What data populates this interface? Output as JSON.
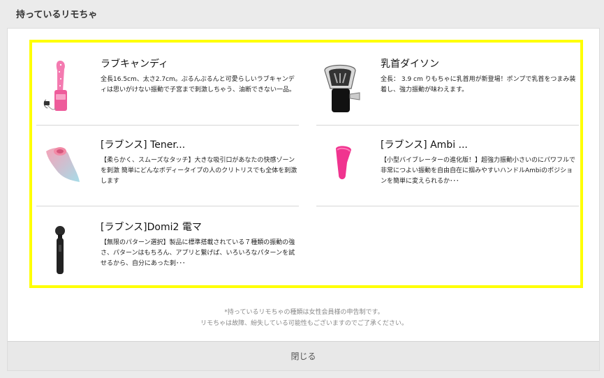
{
  "header": {
    "title": "持っているリモちゃ"
  },
  "items": [
    {
      "name": "ラブキャンディ",
      "description": "全長16.5cm、太さ2.7cm。ぷるんぷるんと可愛らしいラブキャンディは思いがけない振動で子宮まで刺激しちゃう、油断できない一品。",
      "icon": "pink-vibrator-image"
    },
    {
      "name": "乳首ダイソン",
      "description": "全長： 3.9 cm りもちゃに乳首用が新登場！ポンプで乳首をつまみ装着し、強力振動が味わえます。",
      "icon": "nipple-pump-image"
    },
    {
      "name": "[ラブンス] Tener...",
      "description": "【柔らかく、スムーズなタッチ】大きな吸引口があなたの快感ゾーンを刺激 簡単にどんなボディータイプの人のクリトリスでも全体を刺激します",
      "icon": "gradient-suction-toy-image"
    },
    {
      "name": "[ラブンス] Ambi ...",
      "description": "【小型バイブレーターの進化版！】超強力振動小さいのにパワフルで非常につよい振動を自由自在に掴みやすいハンドルAmbiのポジションを簡単に変えられるか･･･",
      "icon": "pink-bullet-vibrator-image"
    },
    {
      "name": "[ラブンス]Domi2 電マ",
      "description": "【無限のパターン選択】製品に標準搭載されている７種類の振動の強さ、パターンはもちろん、アプリと繋げば、いろいろなパターンを試せるから、自分にあった刺･･･",
      "icon": "black-wand-massager-image"
    }
  ],
  "footnote": {
    "line1": "*持っているリモちゃの種類は女性会員様の申告制です。",
    "line2": "リモちゃは故障、紛失している可能性もございますのでご了承ください。"
  },
  "close_button": {
    "label": "閉じる"
  },
  "colors": {
    "highlight": "#ffff00",
    "panel": "#ffffff",
    "background": "#ebebeb"
  }
}
